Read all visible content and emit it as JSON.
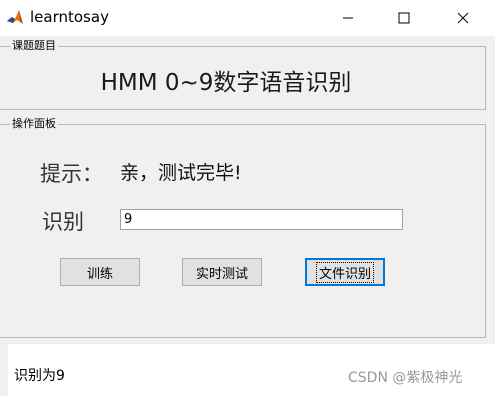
{
  "window": {
    "title": "learntosay",
    "controls": {
      "minimize": "minimize-icon",
      "maximize": "maximize-icon",
      "close": "close-icon"
    }
  },
  "panel1": {
    "label": "课题题目",
    "heading": "HMM 0~9数字语音识别"
  },
  "panel2": {
    "label": "操作面板",
    "hint_label": "提示：",
    "hint_value": "亲，测试完毕!",
    "recog_label": "识别",
    "recog_value": "9",
    "buttons": {
      "train": "训练",
      "realtime": "实时测试",
      "file": "文件识别"
    }
  },
  "status": "识别为9",
  "watermark": "CSDN @紫极神光",
  "colors": {
    "window_bg": "#f0f0f0",
    "focus_border": "#0078d7",
    "icon_orange": "#e8731a"
  }
}
